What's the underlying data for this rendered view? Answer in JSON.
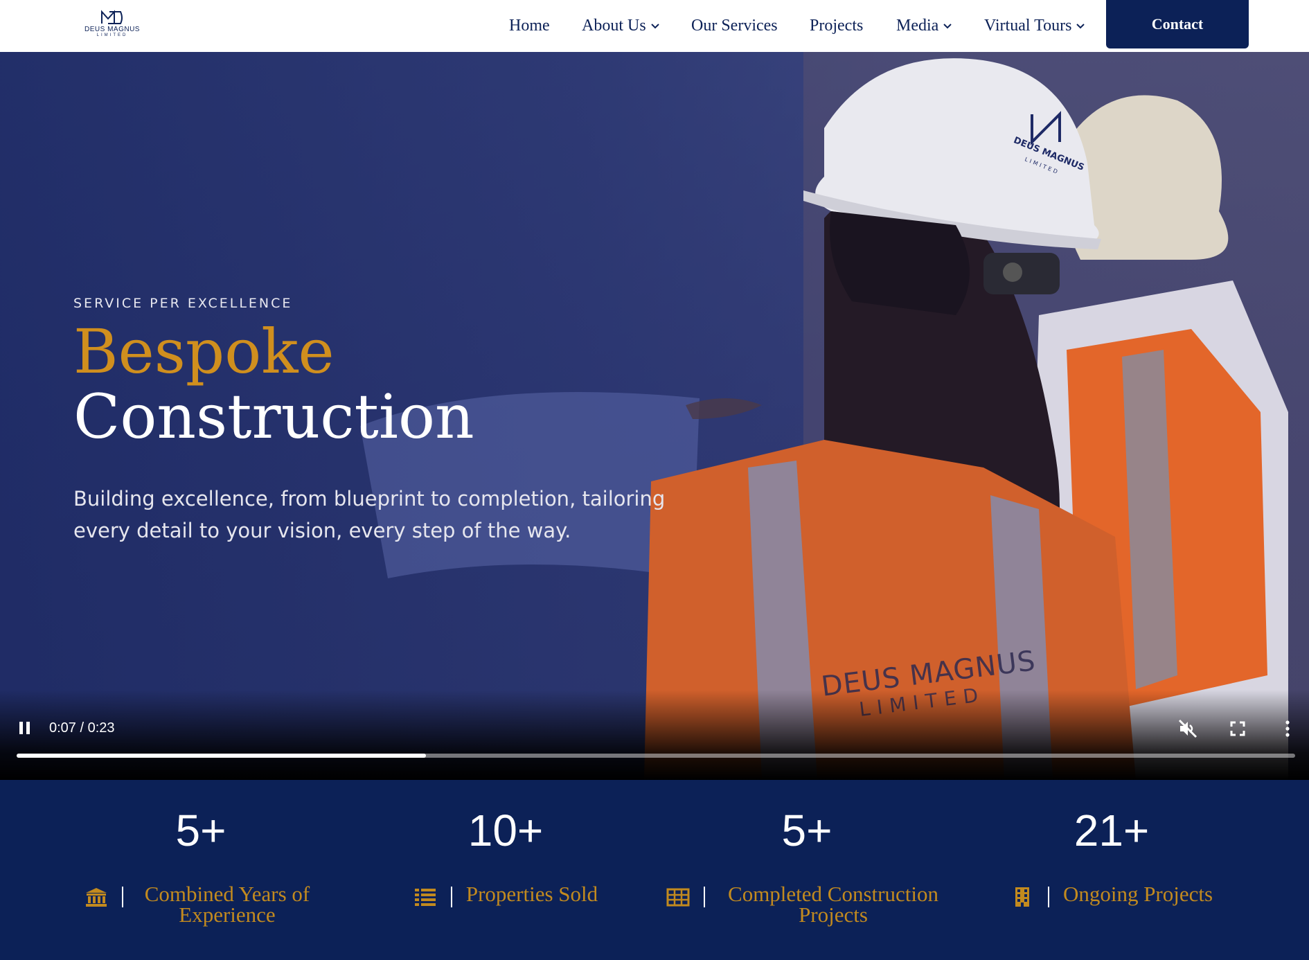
{
  "brand": {
    "name": "DEUS MAGNUS",
    "sub": "LIMITED",
    "navy": "#0c2157",
    "gold": "#c28a1f"
  },
  "nav": {
    "items": [
      {
        "label": "Home",
        "dropdown": false
      },
      {
        "label": "About Us",
        "dropdown": true
      },
      {
        "label": "Our Services",
        "dropdown": false
      },
      {
        "label": "Projects",
        "dropdown": false
      },
      {
        "label": "Media",
        "dropdown": true
      },
      {
        "label": "Virtual Tours",
        "dropdown": true
      }
    ],
    "contact_label": "Contact"
  },
  "hero": {
    "eyebrow": "SERVICE PER EXCELLENCE",
    "title_line1": "Bespoke",
    "title_line2": "Construction",
    "subtitle": "Building excellence, from blueprint to completion, tailoring every detail to your vision, every step of the way.",
    "vest_text": "DEUS MAGNUS",
    "vest_sub": "LIMITED",
    "helmet_text": "DEUS MAGNUS",
    "helmet_sub": "LIMITED"
  },
  "video": {
    "current_time": "0:07",
    "duration": "0:23",
    "time_display": "0:07 / 0:23",
    "progress_fraction": 0.32,
    "muted": true,
    "icons": [
      "pause-icon",
      "mute-icon",
      "fullscreen-icon",
      "more-vert-icon"
    ]
  },
  "stats": [
    {
      "value": "5+",
      "label": "Combined Years of Experience",
      "icon": "bank-icon"
    },
    {
      "value": "10+",
      "label": "Properties Sold",
      "icon": "list-icon"
    },
    {
      "value": "5+",
      "label": "Completed Construction Projects",
      "icon": "table-icon"
    },
    {
      "value": "21+",
      "label": "Ongoing Projects",
      "icon": "building-icon"
    }
  ]
}
